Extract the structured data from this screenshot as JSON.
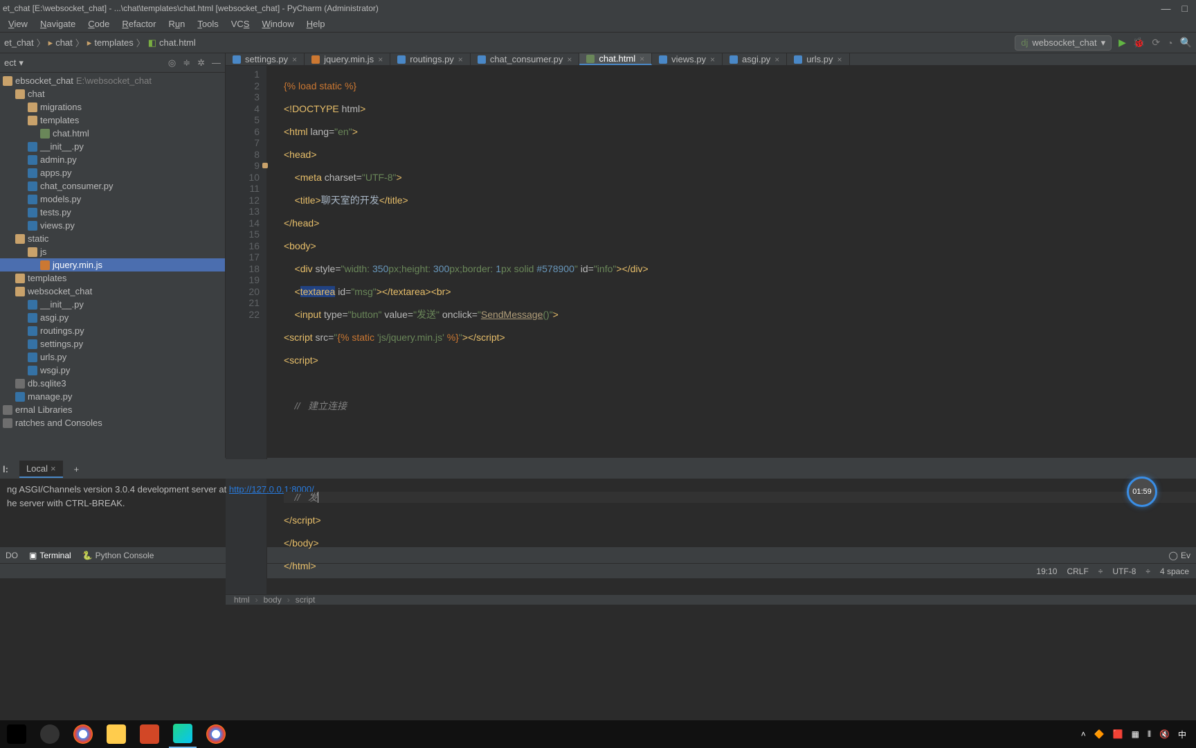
{
  "title": "et_chat [E:\\websocket_chat] - ...\\chat\\templates\\chat.html [websocket_chat] - PyCharm (Administrator)",
  "menu": [
    "View",
    "Navigate",
    "Code",
    "Refactor",
    "Run",
    "Tools",
    "VCS",
    "Window",
    "Help"
  ],
  "breadcrumb": [
    "et_chat",
    "chat",
    "templates",
    "chat.html"
  ],
  "run_config": "websocket_chat",
  "project": {
    "label": "ect",
    "items": [
      {
        "text": "ebsocket_chat",
        "hint": " E:\\websocket_chat",
        "ico": "folder",
        "indent": 0
      },
      {
        "text": "chat",
        "ico": "folder",
        "indent": 1
      },
      {
        "text": "migrations",
        "ico": "folder",
        "indent": 2
      },
      {
        "text": "templates",
        "ico": "folder",
        "indent": 2
      },
      {
        "text": "chat.html",
        "ico": "html",
        "indent": 3
      },
      {
        "text": "__init__.py",
        "ico": "py",
        "indent": 2
      },
      {
        "text": "admin.py",
        "ico": "py",
        "indent": 2
      },
      {
        "text": "apps.py",
        "ico": "py",
        "indent": 2
      },
      {
        "text": "chat_consumer.py",
        "ico": "py",
        "indent": 2
      },
      {
        "text": "models.py",
        "ico": "py",
        "indent": 2
      },
      {
        "text": "tests.py",
        "ico": "py",
        "indent": 2
      },
      {
        "text": "views.py",
        "ico": "py",
        "indent": 2
      },
      {
        "text": "static",
        "ico": "folder",
        "indent": 1
      },
      {
        "text": "js",
        "ico": "folder",
        "indent": 2
      },
      {
        "text": "jquery.min.js",
        "ico": "js",
        "indent": 3,
        "selected": true
      },
      {
        "text": "templates",
        "ico": "folder",
        "indent": 1
      },
      {
        "text": "websocket_chat",
        "ico": "folder",
        "indent": 1
      },
      {
        "text": "__init__.py",
        "ico": "py",
        "indent": 2
      },
      {
        "text": "asgi.py",
        "ico": "py",
        "indent": 2
      },
      {
        "text": "routings.py",
        "ico": "py",
        "indent": 2
      },
      {
        "text": "settings.py",
        "ico": "py",
        "indent": 2
      },
      {
        "text": "urls.py",
        "ico": "py",
        "indent": 2
      },
      {
        "text": "wsgi.py",
        "ico": "py",
        "indent": 2
      },
      {
        "text": "db.sqlite3",
        "ico": "file",
        "indent": 1
      },
      {
        "text": "manage.py",
        "ico": "py",
        "indent": 1
      },
      {
        "text": "ernal Libraries",
        "ico": "lib",
        "indent": 0
      },
      {
        "text": "ratches and Consoles",
        "ico": "scratch",
        "indent": 0
      }
    ]
  },
  "tabs": [
    {
      "label": "settings.py",
      "type": "py"
    },
    {
      "label": "jquery.min.js",
      "type": "js"
    },
    {
      "label": "routings.py",
      "type": "py"
    },
    {
      "label": "chat_consumer.py",
      "type": "py"
    },
    {
      "label": "chat.html",
      "type": "html",
      "active": true
    },
    {
      "label": "views.py",
      "type": "py"
    },
    {
      "label": "asgi.py",
      "type": "py"
    },
    {
      "label": "urls.py",
      "type": "py"
    }
  ],
  "code": {
    "line1": "{% load static %}",
    "line2": "<!DOCTYPE html>",
    "line3": "<html lang=\"en\">",
    "line4": "<head>",
    "line5a": "    <meta charset=\"UTF-8\">",
    "line5b": "聊天室的开发",
    "line6": "    <title>",
    "line6b": "</title>",
    "line7": "</head>",
    "line8": "<body>",
    "line9": "    <div style=\"width: 350px;height: 300px;border: 1px solid #578900\" id=\"info\"></div>",
    "line10": "    <textarea id=\"msg\"></textarea><br>",
    "line11": "    <input type=\"button\" value=\"发送\" onclick=\"SendMessage()\">",
    "line12": "<script src=\"{% static 'js/jquery.min.js' %}\"></scr",
    "line13": "<script>",
    "line15": "//   建立连接",
    "line19": "//   发",
    "line20": "</scr",
    "line21": "</body>",
    "line22": "</html>"
  },
  "crumbs": [
    "html",
    "body",
    "script"
  ],
  "terminal": {
    "label": "l:",
    "tab": "Local",
    "line1_a": "ng ASGI/Channels version 3.0.4 development server at ",
    "line1_b": "http://127.0.0.1:8000/",
    "line2": "he server with CTRL-BREAK."
  },
  "bottom_tools": {
    "todo": "DO",
    "terminal": "Terminal",
    "python_console": "Python Console",
    "event": "Ev"
  },
  "status": {
    "pos": "19:10",
    "sep": "CRLF",
    "enc": "UTF-8",
    "indent": "4 space"
  },
  "timer": "01:59",
  "tray": {
    "ime": "中"
  }
}
